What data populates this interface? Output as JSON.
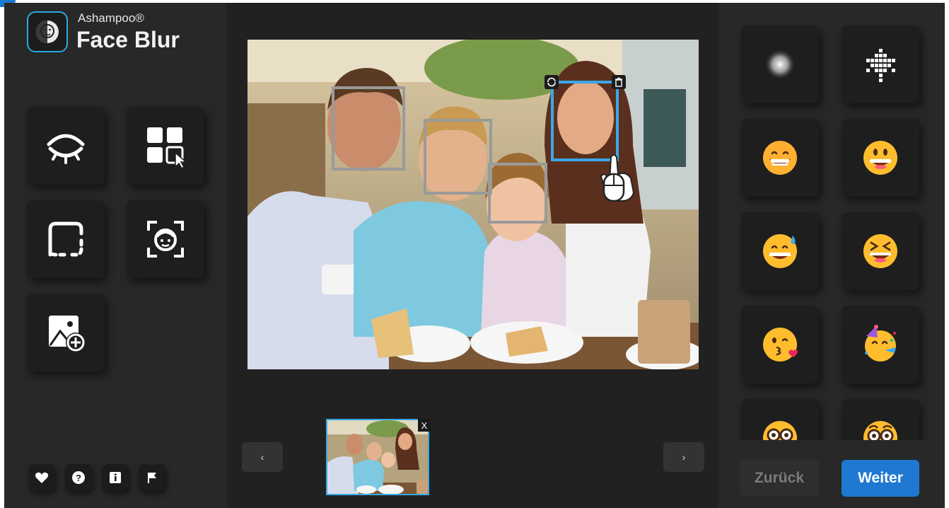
{
  "app": {
    "brand": "Ashampoo®",
    "name": "Face Blur"
  },
  "thumbnail": {
    "close_label": "X"
  },
  "navigation": {
    "prev_label": "‹",
    "next_label": "›"
  },
  "footer": {
    "back_label": "Zurück",
    "next_label": "Weiter"
  },
  "tools": [
    {
      "icon": "eye-closed-icon"
    },
    {
      "icon": "select-grid-icon"
    },
    {
      "icon": "selection-frame-icon"
    },
    {
      "icon": "face-detect-icon"
    },
    {
      "icon": "add-image-icon"
    }
  ],
  "effects": [
    "blur",
    "pixelate",
    "grin-emoji",
    "grinning-emoji",
    "sweat-smile-emoji",
    "squint-laugh-emoji",
    "kiss-emoji",
    "party-emoji",
    "nerd-emoji",
    "glasses-emoji"
  ],
  "footer_icons": [
    "heart-icon",
    "help-icon",
    "info-icon",
    "flag-icon"
  ],
  "colors": {
    "accent": "#1f78d1",
    "selection": "#3aa8e8",
    "background": "#282828"
  }
}
